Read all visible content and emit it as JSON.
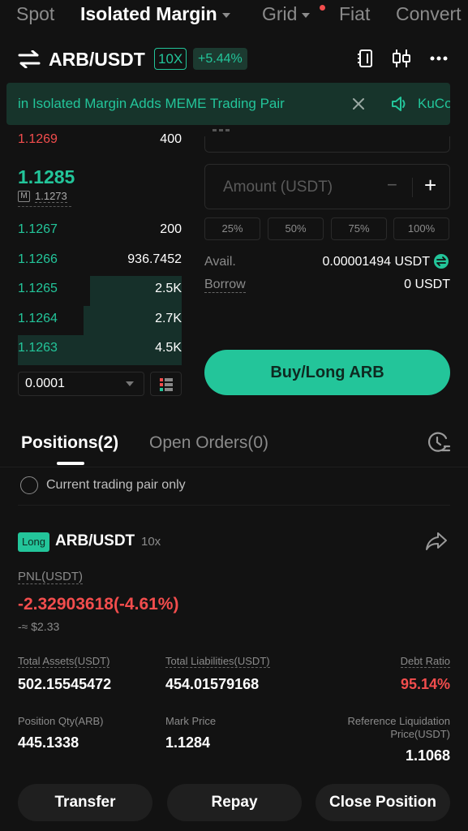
{
  "top_tabs": [
    {
      "label": "Spot"
    },
    {
      "label": "Isolated Margin"
    },
    {
      "label": "Grid"
    },
    {
      "label": "Fiat"
    },
    {
      "label": "Convert"
    }
  ],
  "header": {
    "pair": "ARB/USDT",
    "leverage": "10X",
    "change": "+5.44%"
  },
  "banner": {
    "text": "in Isolated Margin Adds MEME Trading Pair",
    "text2": "KuCo"
  },
  "orderbook": {
    "top_ask_price": "1.1269",
    "top_ask_qty": "400",
    "last_price": "1.1285",
    "mark_badge": "M",
    "mark_price": "1.1273",
    "bids": [
      {
        "price": "1.1267",
        "qty": "200",
        "depth": 0.0
      },
      {
        "price": "1.1266",
        "qty": "936.7452",
        "depth": 0.0
      },
      {
        "price": "1.1265",
        "qty": "2.5K",
        "depth": 0.56
      },
      {
        "price": "1.1264",
        "qty": "2.7K",
        "depth": 0.6
      },
      {
        "price": "1.1263",
        "qty": "4.5K",
        "depth": 1.0
      }
    ],
    "precision": "0.0001"
  },
  "order_form": {
    "amount_placeholder": "Amount (USDT)",
    "minus": "−",
    "plus": "+",
    "percents": [
      "25%",
      "50%",
      "75%",
      "100%"
    ],
    "avail_label": "Avail.",
    "avail_value": "0.00001494 USDT",
    "borrow_label": "Borrow",
    "borrow_value": "0 USDT",
    "buy_label": "Buy/Long ARB"
  },
  "positions": {
    "tab_positions": "Positions(2)",
    "tab_orders": "Open Orders(0)",
    "filter_label": "Current trading pair only",
    "side": "Long",
    "pair": "ARB/USDT",
    "leverage": "10x",
    "pnl_label": "PNL(USDT)",
    "pnl_value": "-2.32903618(-4.61%)",
    "pnl_usd": "-≈ $2.33",
    "total_assets_label": "Total Assets(USDT)",
    "total_assets": "502.15545472",
    "total_liabilities_label": "Total Liabilities(USDT)",
    "total_liabilities": "454.01579168",
    "debt_ratio_label": "Debt Ratio",
    "debt_ratio": "95.14%",
    "position_qty_label": "Position Qty(ARB)",
    "position_qty": "445.1338",
    "mark_price_label": "Mark Price",
    "mark_price": "1.1284",
    "liq_label_1": "Reference Liquidation",
    "liq_label_2": "Price(USDT)",
    "liq_price": "1.1068"
  },
  "actions": {
    "transfer": "Transfer",
    "repay": "Repay",
    "close": "Close Position"
  },
  "colors": {
    "green": "#23c59a",
    "red": "#f24d4d",
    "background": "#121212"
  }
}
